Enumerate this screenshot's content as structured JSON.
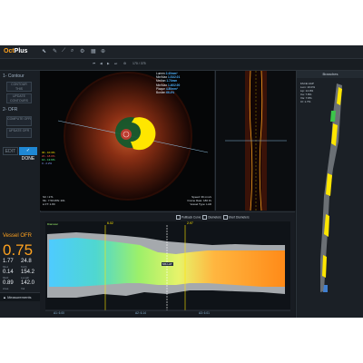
{
  "app": {
    "name_prefix": "Oct",
    "name_suffix": "Plus"
  },
  "toolbar": {
    "frame_counter": "170 / 375"
  },
  "left_panel": {
    "contour_header": "1- Contour",
    "contour_buttons": [
      "CONTOUR THIS",
      "UPDATE CONTOURS"
    ],
    "ofr_header": "2- OFR",
    "ofr_buttons": [
      "COMPUTE OFR",
      "UPDATE OFR"
    ],
    "edit_label": "EDIT",
    "done_label": "✓ DONE",
    "vessel_ofr_label": "Vessel OFR",
    "vessel_ofr_value": "0.75",
    "metrics": [
      {
        "value": "1.77",
        "sub": "MLA"
      },
      {
        "value": "24.8",
        "sub": "%AS"
      },
      {
        "value": "0.14",
        "sub": "MLD"
      },
      {
        "value": "154.2",
        "sub": "Length"
      },
      {
        "value": "0.89",
        "sub": "Area"
      },
      {
        "value": "142.0",
        "sub": "Vol"
      }
    ],
    "measurements_label": "Measurements"
  },
  "oct_view": {
    "info": [
      {
        "k": "Lumen",
        "v": "2.40mm²"
      },
      {
        "k": "Min/Max",
        "v": "1.51/2.01"
      },
      {
        "k": "Median",
        "v": "1.74mm"
      },
      {
        "k": "Min/Max",
        "v": "1.40/2.00"
      },
      {
        "k": "Plaque",
        "v": "4.80mm²"
      },
      {
        "k": "Burden",
        "v": "66.4%"
      }
    ],
    "bottom_left": [
      "SC / 271",
      "ML: 7.50  MIN: 201",
      "● FT: 1.80"
    ],
    "bottom_right": [
      "Speed: 36 mm/s",
      "Frame Rate: 180 f/s",
      "Vessel Type: LAD"
    ],
    "left_legend": [
      "30 - 10.3%",
      "20 - 18.0%",
      "10 - 13.6%",
      "0 - 2.2%"
    ]
  },
  "branches": {
    "title": "Branches",
    "info": [
      "FACE HAP",
      "Lum: 10.0%",
      "Lip: 14.0%",
      "Ca: 7.8%",
      "Vis: 7.8%",
      "Cl: 1.7%"
    ]
  },
  "pullback": {
    "legend": [
      "Pullback Curve",
      "Diameters",
      "Short Diameters"
    ],
    "markers": [
      "6.02",
      "2.97"
    ],
    "cap_label": "MS LAT",
    "bottom_labels": [
      "A1: 6.00",
      "A2: 6.14",
      "A3: 6.01"
    ],
    "left_marker": "Diameter"
  },
  "colors": {
    "accent": "#ffa21f",
    "done": "#1f88d4",
    "lumen": "#ffe600"
  }
}
